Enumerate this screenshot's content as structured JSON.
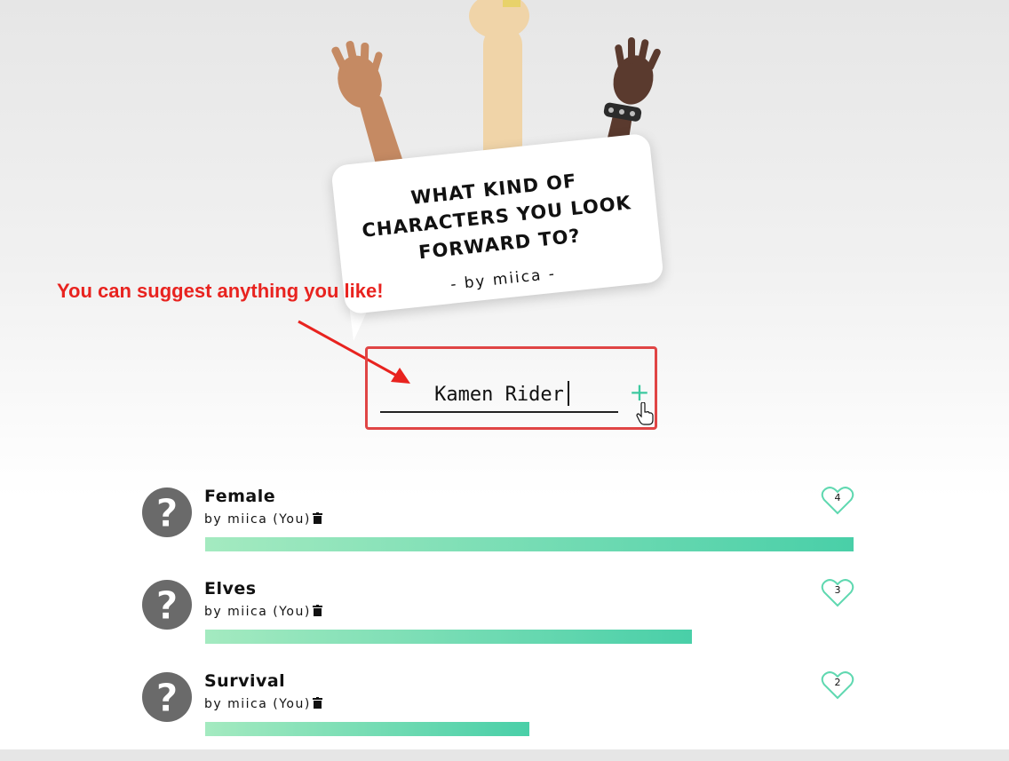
{
  "question": {
    "title": "WHAT KIND OF CHARACTERS YOU LOOK FORWARD TO?",
    "author": "- by miica -"
  },
  "annotation": {
    "text": "You can suggest anything you like!",
    "color": "#e8231f"
  },
  "suggest": {
    "value": "Kamen Rider",
    "add_icon": "plus-icon"
  },
  "suggestions": [
    {
      "name": "Female",
      "by": "by miica (You)",
      "likes": "4",
      "fraction": 1.0
    },
    {
      "name": "Elves",
      "by": "by miica (You)",
      "likes": "3",
      "fraction": 0.75
    },
    {
      "name": "Survival",
      "by": "by miica (You)",
      "likes": "2",
      "fraction": 0.5
    }
  ],
  "colors": {
    "accent": "#3dc9a0",
    "bar_start": "#a4eac0",
    "bar_end": "#49cfa8",
    "highlight_box": "#e04545"
  }
}
